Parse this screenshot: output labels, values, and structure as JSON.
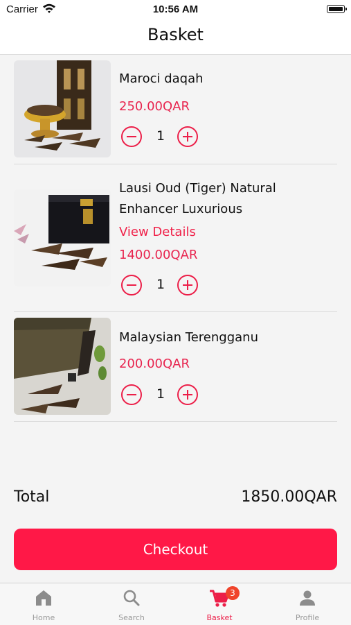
{
  "status_bar": {
    "carrier": "Carrier",
    "time": "10:56 AM"
  },
  "header": {
    "title": "Basket"
  },
  "items": [
    {
      "name": "Maroci daqah",
      "price": "250.00QAR",
      "quantity": "1"
    },
    {
      "name_line1": "Lausi Oud (Tiger) Natural",
      "name_line2": "Enhancer Luxurious",
      "link": "View Details",
      "price": "1400.00QAR",
      "quantity": "1"
    },
    {
      "name": "Malaysian Terengganu",
      "price": "200.00QAR",
      "quantity": "1"
    }
  ],
  "summary": {
    "total_label": "Total",
    "total_value": "1850.00QAR"
  },
  "checkout_label": "Checkout",
  "tabs": [
    {
      "label": "Home",
      "icon": "home-icon"
    },
    {
      "label": "Search",
      "icon": "search-icon"
    },
    {
      "label": "Basket",
      "icon": "cart-icon",
      "badge": "3",
      "active": true
    },
    {
      "label": "Profile",
      "icon": "person-icon"
    }
  ],
  "colors": {
    "accent": "#ff1847",
    "price": "#e8254f",
    "badge": "#f0442b"
  }
}
